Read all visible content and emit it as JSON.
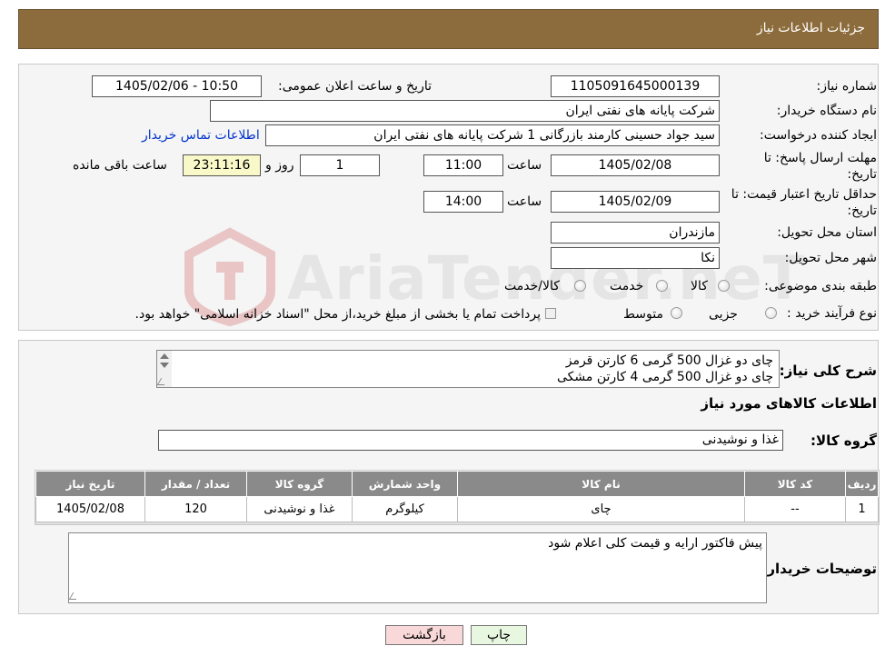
{
  "header": {
    "title": "جزئیات اطلاعات نیاز"
  },
  "form": {
    "need_number_label": "شماره نیاز:",
    "need_number": "1105091645000139",
    "announce_label": "تاریخ و ساعت اعلان عمومی:",
    "announce_value": "1405/02/06 - 10:50",
    "buyer_org_label": "نام دستگاه خریدار:",
    "buyer_org": "شرکت پایانه های نفتی ایران",
    "creator_label": "ایجاد کننده درخواست:",
    "creator": "سید جواد حسینی کارمند بازرگانی 1 شرکت پایانه های نفتی ایران",
    "contact_link": "اطلاعات تماس خریدار",
    "deadline_label": "مهلت ارسال پاسخ: تا تاریخ:",
    "deadline_date": "1405/02/08",
    "time_label": "ساعت",
    "deadline_time": "11:00",
    "days_value": "1",
    "days_label": "روز و",
    "remaining_time": "23:11:16",
    "remaining_label": "ساعت باقی مانده",
    "validity_label": "حداقل تاریخ اعتبار قیمت: تا تاریخ:",
    "validity_date": "1405/02/09",
    "validity_time": "14:00",
    "province_label": "استان محل تحویل:",
    "province": "مازندران",
    "city_label": "شهر محل تحویل:",
    "city": "نکا",
    "category_label": "طبقه بندی موضوعی:",
    "category_options": [
      "کالا",
      "خدمت",
      "کالا/خدمت"
    ],
    "process_label": "نوع فرآیند خرید :",
    "process_options": [
      "جزیی",
      "متوسط"
    ],
    "process_note": "پرداخت تمام یا بخشی از مبلغ خرید،از محل \"اسناد خزانه اسلامی\" خواهد بود."
  },
  "details": {
    "description_label": "شرح کلی نیاز:",
    "description_lines": [
      "چای دو غزال 500 گرمی 6 کارتن قرمز",
      "چای دو غزال 500 گرمی 4 کارتن مشکی"
    ],
    "goods_info_title": "اطلاعات کالاهای مورد نیاز",
    "goods_group_label": "گروه کالا:",
    "goods_group": "غذا و نوشیدنی",
    "table": {
      "headers": [
        "ردیف",
        "کد کالا",
        "نام کالا",
        "واحد شمارش",
        "گروه کالا",
        "تعداد / مقدار",
        "تاریخ نیاز"
      ],
      "rows": [
        [
          "1",
          "--",
          "چای",
          "کیلوگرم",
          "غذا و نوشیدنی",
          "120",
          "1405/02/08"
        ]
      ]
    },
    "buyer_notes_label": "توضیحات خریدار:",
    "buyer_notes": "پیش فاکتور ارایه و قیمت کلی اعلام شود"
  },
  "buttons": {
    "print": "چاپ",
    "back": "بازگشت"
  },
  "watermark": {
    "text": "AriaTender.neT"
  },
  "colors": {
    "header": "#8c6c3c",
    "link": "#0033cc",
    "back_button": "#f8d8d8",
    "print_button": "#e8f8e0"
  }
}
